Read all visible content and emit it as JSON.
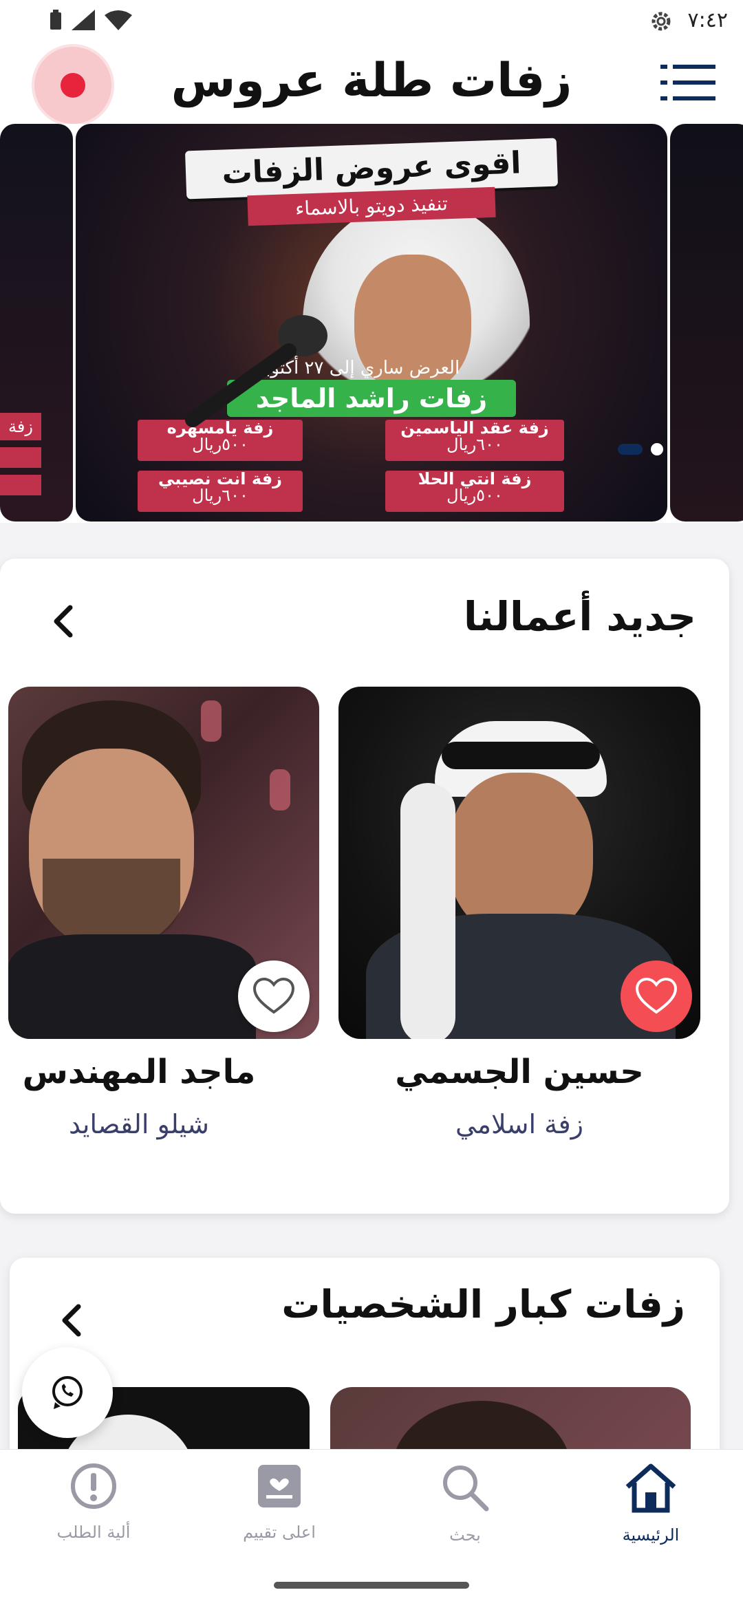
{
  "status_bar": {
    "time": "٧:٤٢"
  },
  "app": {
    "title": "زفات طلة عروس"
  },
  "carousel": {
    "headline": "اقوى عروض الزفات",
    "subheadline": "تنفيذ دويتو بالاسماء",
    "offer": "العرض ساري إلى ٢٧ أكتوبر",
    "artist_banner": "زفات راشد الماجد",
    "items": [
      {
        "title": "زفة عقد الياسمين",
        "price": "٦٠٠ريال"
      },
      {
        "title": "زفة يامسهره",
        "price": "٥٠٠ريال"
      },
      {
        "title": "زفة انتي الحلا",
        "price": "٥٠٠ريال"
      },
      {
        "title": "زفة انت نصيبي",
        "price": "٦٠٠ريال"
      }
    ],
    "peek_left_text": "زفة"
  },
  "sections": {
    "new_works": {
      "title": "جديد أعمالنا",
      "cards": [
        {
          "name": "حسين الجسمي",
          "genre": "زفة اسلامي",
          "favorited": true
        },
        {
          "name": "ماجد المهندس",
          "genre": "شيلو القصايد",
          "favorited": false
        }
      ]
    },
    "vip": {
      "title": "زفات كبار الشخصيات"
    }
  },
  "bottom_nav": [
    {
      "label": "الرئيسية",
      "icon": "home-icon",
      "active": true
    },
    {
      "label": "بحث",
      "icon": "search-icon",
      "active": false
    },
    {
      "label": "اعلى تقييم",
      "icon": "rating-icon",
      "active": false
    },
    {
      "label": "ألية الطلب",
      "icon": "info-icon",
      "active": false
    }
  ],
  "colors": {
    "primary": "#0d2c5c",
    "accent_red": "#f44d54",
    "record_red": "#e8243c",
    "promo_green": "#35b34a",
    "promo_pink": "#c0314c"
  }
}
